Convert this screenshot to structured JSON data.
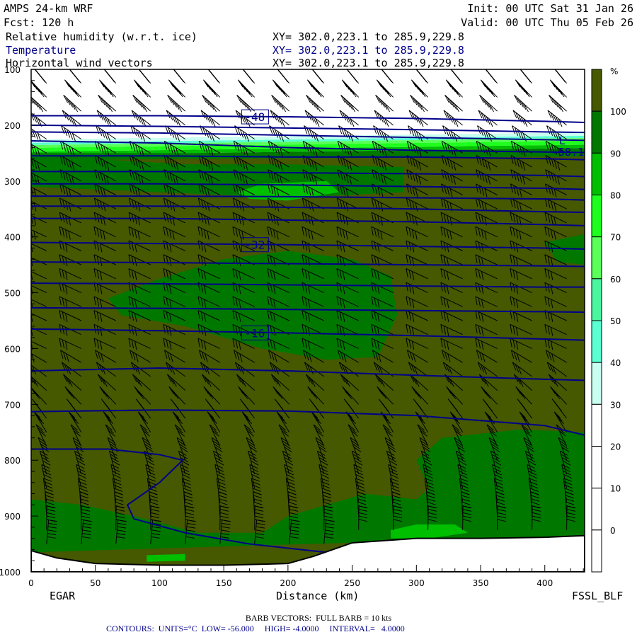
{
  "header": {
    "model": "AMPS 24-km WRF",
    "init": "Init: 00 UTC Sat 31 Jan 26",
    "fcst": "Fcst: 120 h",
    "valid": "Valid: 00 UTC Thu 05 Feb 26",
    "fields": [
      {
        "name": "Relative humidity (w.r.t. ice)",
        "xy": "XY= 302.0,223.1 to 285.9,229.8"
      },
      {
        "name": "Temperature",
        "xy": "XY= 302.0,223.1 to 285.9,229.8"
      },
      {
        "name": "Horizontal wind vectors",
        "xy": "XY= 302.0,223.1 to 285.9,229.8"
      }
    ]
  },
  "footer": {
    "barb": "BARB VECTORS:  FULL BARB = 10 kts",
    "contours": "CONTOURS:  UNITS=°C  LOW= -56.000     HIGH= -4.0000     INTERVAL=   4.0000"
  },
  "colors": {
    "temperature": "#00008b",
    "terrain": "#ffffff",
    "barbs": "#000000"
  },
  "chart_data": {
    "type": "heatmap",
    "xlabel": "Distance (km)",
    "ylabel": "",
    "x_ticks": [
      0,
      50,
      100,
      150,
      200,
      250,
      300,
      350,
      400
    ],
    "y_ticks": [
      100,
      200,
      300,
      400,
      500,
      600,
      700,
      800,
      900,
      1000
    ],
    "xlim": [
      0,
      431
    ],
    "ylim": [
      1000,
      100
    ],
    "endpoints": {
      "left": "EGAR",
      "right": "FSSL_BLF"
    },
    "colorbar": {
      "unit": "%",
      "labels": [
        "100",
        "90",
        "80",
        "70",
        "60",
        "50",
        "40",
        "30",
        "20",
        "10",
        "0"
      ],
      "bins": [
        {
          "min": 100,
          "color": "#465800"
        },
        {
          "min": 90,
          "color": "#007800"
        },
        {
          "min": 80,
          "color": "#00be00"
        },
        {
          "min": 70,
          "color": "#1eff1e"
        },
        {
          "min": 60,
          "color": "#5aff5a"
        },
        {
          "min": 50,
          "color": "#4cf5a0"
        },
        {
          "min": 40,
          "color": "#5affd2"
        },
        {
          "min": 30,
          "color": "#c8fff0"
        },
        {
          "min": 20,
          "color": "#ffffff"
        },
        {
          "min": 10,
          "color": "#ffffff"
        },
        {
          "min": 0,
          "color": "#ffffff"
        },
        {
          "min": -10,
          "color": "#ffffff"
        }
      ]
    },
    "rh_layers_top_band": [
      {
        "min": 30,
        "p_top": 218,
        "p_bottom": 224
      },
      {
        "min": 40,
        "p_top": 224,
        "p_bottom": 228
      },
      {
        "min": 60,
        "p_top": 228,
        "p_bottom": 233
      },
      {
        "min": 70,
        "p_top": 233,
        "p_bottom": 240
      },
      {
        "min": 80,
        "p_top": 240,
        "p_bottom": 246
      },
      {
        "min": 90,
        "p_top": 246,
        "p_bottom": 256
      }
    ],
    "rh_regions": [
      {
        "min": 90,
        "points": [
          [
            0,
            250
          ],
          [
            431,
            250
          ],
          [
            431,
            256
          ],
          [
            0,
            262
          ]
        ]
      },
      {
        "min": 90,
        "points": [
          [
            0,
            262
          ],
          [
            60,
            262
          ],
          [
            120,
            270
          ],
          [
            200,
            270
          ],
          [
            290,
            275
          ],
          [
            290,
            320
          ],
          [
            200,
            330
          ],
          [
            100,
            320
          ],
          [
            0,
            310
          ]
        ]
      },
      {
        "min": 80,
        "points": [
          [
            160,
            320
          ],
          [
            180,
            305
          ],
          [
            230,
            300
          ],
          [
            240,
            320
          ],
          [
            200,
            335
          ],
          [
            170,
            332
          ]
        ]
      },
      {
        "min": 90,
        "points": [
          [
            60,
            510
          ],
          [
            100,
            475
          ],
          [
            150,
            440
          ],
          [
            200,
            425
          ],
          [
            250,
            440
          ],
          [
            280,
            470
          ],
          [
            285,
            540
          ],
          [
            270,
            615
          ],
          [
            230,
            620
          ],
          [
            180,
            600
          ],
          [
            120,
            560
          ],
          [
            70,
            540
          ]
        ]
      },
      {
        "min": 90,
        "points": [
          [
            400,
            410
          ],
          [
            431,
            395
          ],
          [
            431,
            450
          ],
          [
            410,
            445
          ]
        ]
      },
      {
        "min": 90,
        "points": [
          [
            0,
            870
          ],
          [
            40,
            880
          ],
          [
            80,
            900
          ],
          [
            130,
            930
          ],
          [
            180,
            930
          ],
          [
            200,
            900
          ],
          [
            230,
            880
          ],
          [
            260,
            860
          ],
          [
            300,
            870
          ],
          [
            310,
            850
          ],
          [
            300,
            800
          ],
          [
            320,
            760
          ],
          [
            380,
            745
          ],
          [
            431,
            750
          ],
          [
            431,
            935
          ],
          [
            0,
            965
          ]
        ]
      },
      {
        "min": 80,
        "points": [
          [
            280,
            925
          ],
          [
            300,
            915
          ],
          [
            330,
            915
          ],
          [
            340,
            930
          ],
          [
            310,
            940
          ],
          [
            280,
            940
          ]
        ]
      },
      {
        "min": 80,
        "points": [
          [
            90,
            970
          ],
          [
            120,
            968
          ],
          [
            120,
            980
          ],
          [
            90,
            982
          ]
        ]
      }
    ],
    "temperature_contours": {
      "x": [
        0,
        100,
        200,
        300,
        400,
        431
      ],
      "lines": [
        {
          "label": "-48",
          "p": [
            183,
            183,
            185,
            188,
            193,
            195
          ]
        },
        {
          "label": "",
          "p": [
            200,
            202,
            205,
            208,
            212,
            213
          ]
        },
        {
          "label": "",
          "p": [
            212,
            214,
            218,
            222,
            226,
            227
          ]
        },
        {
          "label": "",
          "p": [
            228,
            232,
            240,
            245,
            248,
            249
          ]
        },
        {
          "label": "-58.1",
          "p": [
            255,
            255,
            257,
            257,
            260,
            262
          ]
        },
        {
          "label": "",
          "p": [
            283,
            283,
            285,
            287,
            290,
            292
          ]
        },
        {
          "label": "",
          "p": [
            305,
            305,
            307,
            310,
            313,
            315
          ]
        },
        {
          "label": "",
          "p": [
            327,
            327,
            328,
            330,
            332,
            334
          ]
        },
        {
          "label": "",
          "p": [
            345,
            345,
            347,
            350,
            355,
            356
          ]
        },
        {
          "label": "",
          "p": [
            367,
            367,
            370,
            373,
            378,
            380
          ]
        },
        {
          "label": "-32",
          "p": [
            410,
            412,
            414,
            417,
            420,
            422
          ]
        },
        {
          "label": "",
          "p": [
            445,
            446,
            448,
            450,
            452,
            453
          ]
        },
        {
          "label": "",
          "p": [
            483,
            484,
            486,
            488,
            490,
            490
          ]
        },
        {
          "label": "",
          "p": [
            527,
            528,
            530,
            532,
            534,
            535
          ]
        },
        {
          "label": "-16",
          "p": [
            565,
            568,
            572,
            577,
            583,
            585
          ]
        },
        {
          "label": "",
          "p": [
            640,
            635,
            640,
            648,
            655,
            657
          ]
        },
        {
          "label": "",
          "p": [
            713,
            710,
            712,
            720,
            738,
            755
          ]
        }
      ],
      "curve": [
        [
          0,
          780
        ],
        [
          60,
          780
        ],
        [
          100,
          790
        ],
        [
          118,
          800
        ],
        [
          100,
          840
        ],
        [
          75,
          880
        ],
        [
          80,
          905
        ],
        [
          120,
          930
        ],
        [
          170,
          950
        ],
        [
          210,
          960
        ],
        [
          230,
          965
        ]
      ]
    },
    "terrain_surface_p": {
      "x": [
        0,
        20,
        50,
        100,
        150,
        200,
        220,
        250,
        300,
        350,
        400,
        431
      ],
      "p": [
        962,
        975,
        985,
        988,
        988,
        985,
        972,
        948,
        940,
        940,
        938,
        935
      ]
    },
    "wind": {
      "columns_km": [
        12,
        39,
        66,
        93,
        120,
        147,
        174,
        201,
        228,
        255,
        282,
        309,
        336,
        363,
        390,
        417
      ],
      "levels_hpa": [
        125,
        150,
        175,
        200,
        225,
        250,
        275,
        300,
        325,
        350,
        375,
        400,
        425,
        450,
        475,
        500,
        525,
        550,
        575,
        600,
        625,
        650,
        675,
        700,
        725,
        750,
        775,
        800,
        825,
        850,
        875,
        900,
        925,
        950
      ],
      "profile": [
        {
          "p": 100,
          "speed_kt": 45,
          "dir_deg": 215
        },
        {
          "p": 250,
          "speed_kt": 50,
          "dir_deg": 240
        },
        {
          "p": 400,
          "speed_kt": 35,
          "dir_deg": 245
        },
        {
          "p": 600,
          "speed_kt": 25,
          "dir_deg": 245
        },
        {
          "p": 800,
          "speed_kt": 35,
          "dir_deg": 200
        },
        {
          "p": 950,
          "speed_kt": 55,
          "dir_deg": 175
        }
      ]
    }
  }
}
